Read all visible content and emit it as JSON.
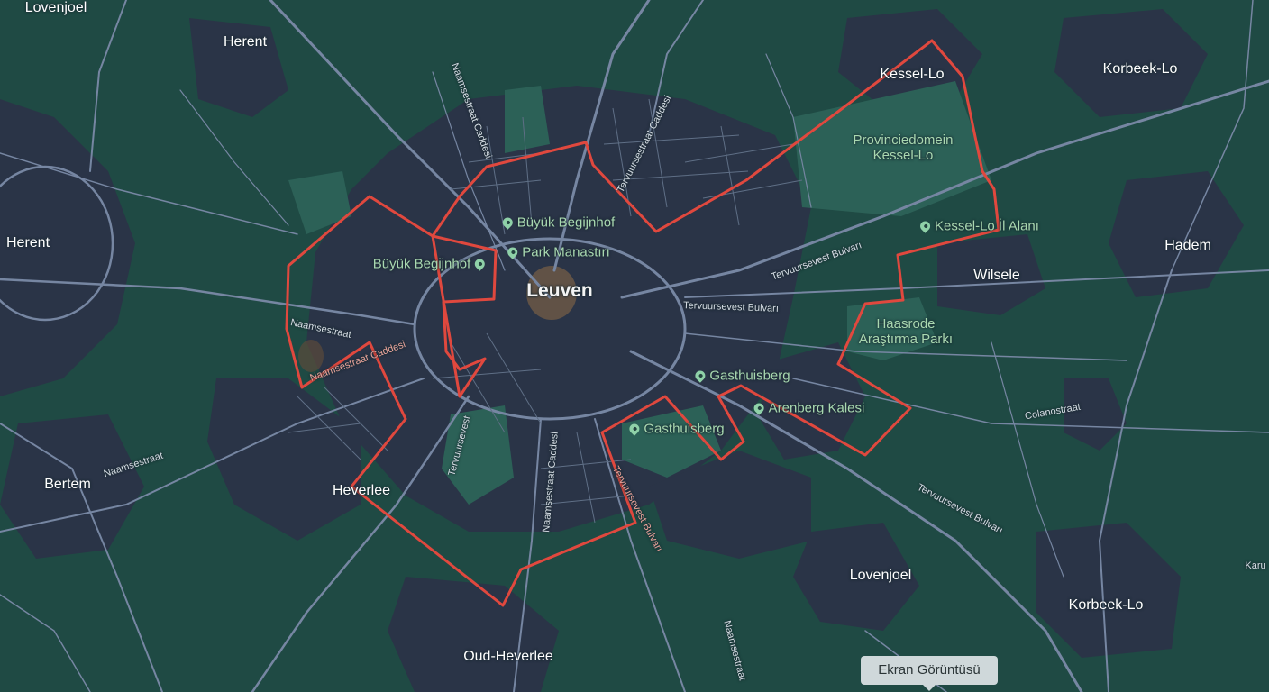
{
  "colors": {
    "background": "#1f4a44",
    "urban": "#2a3447",
    "road": "#7686a2",
    "boundary": "#e0483e",
    "park_label": "#a9d8b0",
    "center_highlight": "#6b5846"
  },
  "map": {
    "center_city": "Leuven",
    "cities": [
      {
        "id": "lovenjoel-nw",
        "label": "Lovenjoel"
      },
      {
        "id": "herent-n",
        "label": "Herent"
      },
      {
        "id": "herent-w",
        "label": "Herent"
      },
      {
        "id": "kessel-lo",
        "label": "Kessel-Lo"
      },
      {
        "id": "korbeek-lo-ne",
        "label": "Korbeek-Lo"
      },
      {
        "id": "haasrode-e",
        "label": "Hadem"
      },
      {
        "id": "wilsele",
        "label": "Wilsele"
      },
      {
        "id": "bertem",
        "label": "Bertem"
      },
      {
        "id": "heverlee",
        "label": "Heverlee"
      },
      {
        "id": "lovenjoel-se",
        "label": "Lovenjoel"
      },
      {
        "id": "korbeek-lo-se",
        "label": "Korbeek-Lo"
      },
      {
        "id": "oud-heverlee",
        "label": "Oud-Heverlee"
      }
    ],
    "parks": [
      {
        "id": "provinciedomein",
        "label_line1": "Provinciedomein",
        "label_line2": "Kessel-Lo"
      },
      {
        "id": "haasrode-park",
        "label_line1": "Haasrode",
        "label_line2": "Araştırma Parkı"
      }
    ],
    "pois": [
      {
        "id": "buyuk-begijnhof-n",
        "label": "Büyük Begijnhof",
        "icon": "map-pin-icon"
      },
      {
        "id": "park-manastiri",
        "label": "Park Manastırı",
        "icon": "map-pin-icon"
      },
      {
        "id": "buyuk-begijnhof-w",
        "label": "Büyük Begijnhof",
        "icon": "map-pin-icon"
      },
      {
        "id": "kessel-lo-il-alani",
        "label": "Kessel-Lo İl Alanı",
        "icon": "map-pin-icon"
      },
      {
        "id": "gasthuisberg-n",
        "label": "Gasthuisberg",
        "icon": "map-pin-icon"
      },
      {
        "id": "arenberg-kalesi",
        "label": "Arenberg Kalesi",
        "icon": "map-pin-icon"
      },
      {
        "id": "gasthuisberg-s",
        "label": "Gasthuisberg",
        "icon": "map-pin-icon"
      }
    ],
    "streets": [
      {
        "id": "st1",
        "label": "Naamsestraat Caddesi"
      },
      {
        "id": "st2",
        "label": "Tervuursestraat Caddesi"
      },
      {
        "id": "st3",
        "label": "Tervuursevest Bulvarı"
      },
      {
        "id": "st4",
        "label": "Tervuursevest Bulvarı"
      },
      {
        "id": "st5",
        "label": "Naamsestraat"
      },
      {
        "id": "st6",
        "label": "Naamsestraat Caddesi"
      },
      {
        "id": "st7",
        "label": "Tervuursevest"
      },
      {
        "id": "st8",
        "label": "Naamsestraat Caddesi"
      },
      {
        "id": "st9",
        "label": "Tervuursevest Bulvarı"
      },
      {
        "id": "st10",
        "label": "Naamsestraat"
      },
      {
        "id": "st11",
        "label": "Colanostraat"
      },
      {
        "id": "st12",
        "label": "Tervuursevest Bulvarı"
      },
      {
        "id": "st13",
        "label": "Naamsestraat"
      },
      {
        "id": "st14",
        "label": "Karu"
      }
    ]
  },
  "tooltip": {
    "label": "Ekran Görüntüsü"
  }
}
